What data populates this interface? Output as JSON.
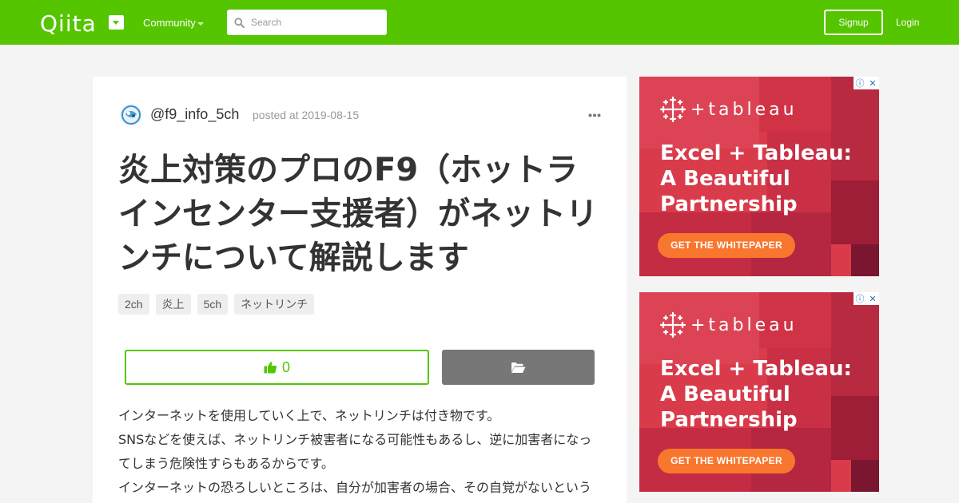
{
  "header": {
    "logo": "Qiita",
    "community": "Community",
    "search_placeholder": "Search",
    "signup": "Signup",
    "login": "Login",
    "brand_color": "#55c500"
  },
  "article": {
    "username": "@f9_info_5ch",
    "posted": "posted at 2019-08-15",
    "title": "炎上対策のプロのF9（ホットラインセンター支援者）がネットリンチについて解説します",
    "tags": [
      "2ch",
      "炎上",
      "5ch",
      "ネットリンチ"
    ],
    "like_count": "0",
    "body": [
      "インターネットを使用していく上で、ネットリンチは付き物です。",
      "SNSなどを使えば、ネットリンチ被害者になる可能性もあるし、逆に加害者になっ",
      "てしまう危険性すらもあるからです。",
      "インターネットの恐ろしいところは、自分が加害者の場合、その自覚がないという"
    ]
  },
  "ads": [
    {
      "brand": "+tableau",
      "headline": [
        "Excel + Tableau:",
        "A Beautiful",
        "Partnership"
      ],
      "cta": "GET THE WHITEPAPER"
    },
    {
      "brand": "+tableau",
      "headline": [
        "Excel + Tableau:",
        "A Beautiful",
        "Partnership"
      ],
      "cta": "GET THE WHITEPAPER"
    }
  ]
}
